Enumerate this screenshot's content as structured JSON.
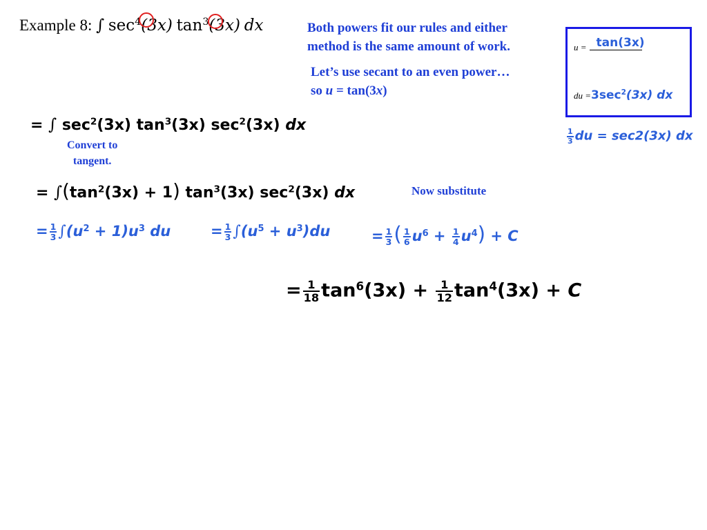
{
  "title": {
    "label": "Example 8:",
    "integral": "∫",
    "sec": "sec",
    "sec_power": "4",
    "arg1": "(3x)",
    "tan": "tan",
    "tan_power": "3",
    "arg2": "(3x)",
    "dx": "dx"
  },
  "note_powers": {
    "line1": "Both powers fit our rules and either",
    "line2": "method is the same amount of work."
  },
  "note_secant": {
    "line1": "Let’s use secant to an even power…",
    "line2_prefix": "so ",
    "line2_u": "u",
    "line2_suffix": " = tan(3",
    "line2_x": "x",
    "line2_end": ")"
  },
  "sub_box": {
    "u_label": "u =",
    "u_value": "tan(3x)",
    "du_label": "du =",
    "du_value_coef": "3sec",
    "du_value_power": "2",
    "du_value_rest": "(3x) dx",
    "accent_color": "#1a1ae6"
  },
  "du_relation": {
    "frac_num": "1",
    "frac_den": "3",
    "rest": "du = sec2(3x) dx"
  },
  "step1": {
    "eq": "=",
    "integral": "∫",
    "t1": "sec",
    "p1": "2",
    "a1": "(3x)",
    "t2": "tan",
    "p2": "3",
    "a2": "(3x)",
    "t3": "sec",
    "p3": "2",
    "a3": "(3x)",
    "dx": "dx",
    "note_line1": "Convert to",
    "note_line2": "tangent."
  },
  "step2": {
    "eq": "=",
    "integral": "∫",
    "open": "(",
    "t1": "tan",
    "p1": "2",
    "a1": "(3x) + 1",
    "close": ")",
    "t2": "tan",
    "p2": "3",
    "a2": "(3x)",
    "t3": "sec",
    "p3": "2",
    "a3": "(3x)",
    "dx": "dx",
    "note": "Now substitute"
  },
  "step3": {
    "part1": {
      "eq": "=",
      "num": "1",
      "den": "3",
      "integral": "∫",
      "body_a": "(u",
      "pa": "2",
      "body_b": " + 1)u",
      "pb": "3",
      "tail": " du"
    },
    "part2": {
      "eq": "=",
      "num": "1",
      "den": "3",
      "integral": "∫",
      "body_a": "(u",
      "pa": "5",
      "body_b": " + u",
      "pb": "3",
      "tail": ")du"
    },
    "part3": {
      "eq": "=",
      "num": "1",
      "den": "3",
      "open": "(",
      "f1_num": "1",
      "f1_den": "6",
      "u1": "u",
      "p1": "6",
      "plus": " + ",
      "f2_num": "1",
      "f2_den": "4",
      "u2": "u",
      "p2": "4",
      "close": ")",
      "tail": " + C"
    }
  },
  "result": {
    "eq": "=",
    "f1_num": "1",
    "f1_den": "18",
    "t1": "tan",
    "p1": "6",
    "a1": "(3x) + ",
    "f2_num": "1",
    "f2_den": "12",
    "t2": "tan",
    "p2": "4",
    "a2": "(3x)",
    "tail": " + C"
  },
  "colors": {
    "note_blue": "#1f3fd6",
    "math_blue": "#2b5fd9",
    "highlight_red": "#e02020"
  }
}
